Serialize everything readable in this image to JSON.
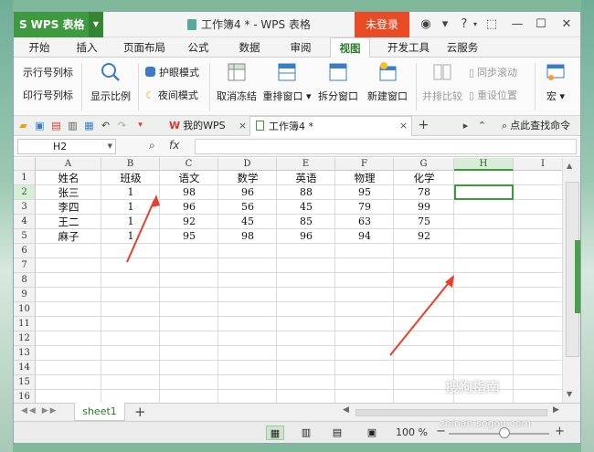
{
  "app": {
    "logo": "WPS 表格",
    "doc_title": "工作簿4 * - WPS 表格",
    "login": "未登录"
  },
  "menu": [
    "开始",
    "插入",
    "页面布局",
    "公式",
    "数据",
    "审阅",
    "视图",
    "开发工具",
    "云服务"
  ],
  "ribbon": {
    "row_col_title": "示行号列标",
    "print_row_col": "印行号列标",
    "zoom_label": "显示比例",
    "eye_mode": "护眼模式",
    "night_mode": "夜间模式",
    "unfreeze": "取消冻结",
    "arrange": "重排窗口",
    "split": "拆分窗口",
    "new_window": "新建窗口",
    "side_by_side": "并排比较",
    "sync_scroll": "同步滚动",
    "reset_pos": "重设位置",
    "macro": "宏"
  },
  "tabs": {
    "mywps": "我的WPS",
    "doc": "工作簿4 *",
    "search": "点此查找命令"
  },
  "formula": {
    "cell_ref": "H2",
    "fx": "fx",
    "value": ""
  },
  "columns": [
    "A",
    "B",
    "C",
    "D",
    "E",
    "F",
    "G",
    "H",
    "I"
  ],
  "rows": [
    "1",
    "2",
    "3",
    "4",
    "5",
    "6",
    "7",
    "8",
    "9",
    "10",
    "11",
    "12",
    "13",
    "14",
    "15",
    "16"
  ],
  "table": {
    "header": [
      "姓名",
      "班级",
      "语文",
      "数学",
      "英语",
      "物理",
      "化学"
    ],
    "data": [
      [
        "张三",
        "1",
        "98",
        "96",
        "88",
        "95",
        "78"
      ],
      [
        "李四",
        "1",
        "96",
        "56",
        "45",
        "79",
        "99"
      ],
      [
        "王二",
        "1",
        "92",
        "45",
        "85",
        "63",
        "75"
      ],
      [
        "麻子",
        "1",
        "95",
        "98",
        "96",
        "94",
        "92"
      ]
    ]
  },
  "sheet": {
    "name": "sheet1"
  },
  "status": {
    "zoom": "100 %"
  },
  "watermark": {
    "brand": "搜狗指南",
    "url": "zhinan.sogou.com"
  },
  "colors": {
    "accent": "#3e9a3e",
    "login": "#e94b25",
    "arrow": "#e8402a"
  }
}
